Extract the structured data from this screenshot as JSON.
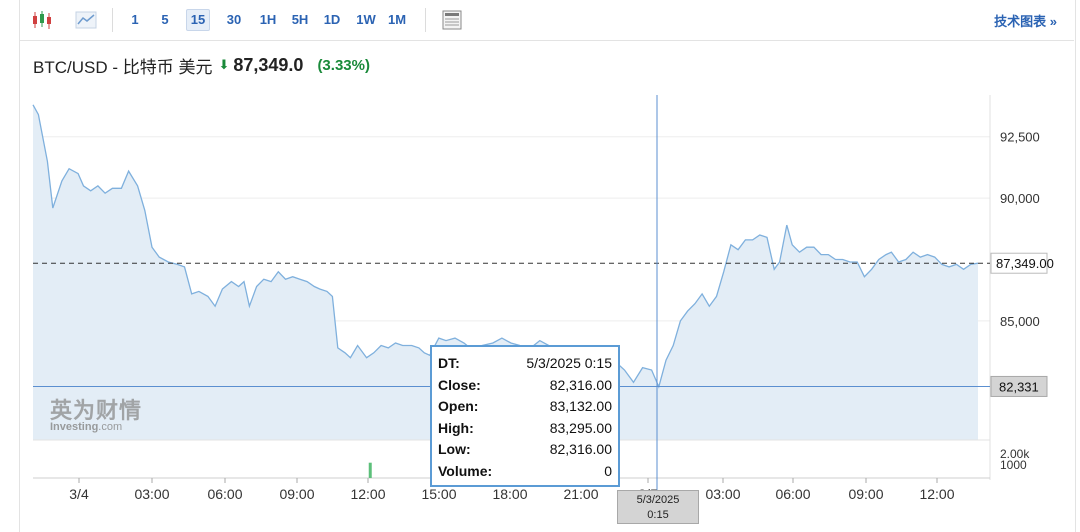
{
  "toolbar": {
    "intervals": [
      "1",
      "5",
      "15",
      "30",
      "1H",
      "5H",
      "1D",
      "1W",
      "1M"
    ],
    "active_interval": "15",
    "tech_link": "技术图表 »"
  },
  "header": {
    "symbol": "BTC/USD - 比特币 美元",
    "arrow": "⬇",
    "price": "87,349.0",
    "change": "(3.33%)",
    "change_color": "#1a8a3a"
  },
  "watermark": {
    "cn": "英为财情",
    "en_bold": "Investing",
    "en_suffix": ".com"
  },
  "tooltip": {
    "rows": [
      {
        "k": "DT:",
        "v": "5/3/2025 0:15"
      },
      {
        "k": "Close:",
        "v": "82,316.00"
      },
      {
        "k": "Open:",
        "v": "83,132.00"
      },
      {
        "k": "High:",
        "v": "83,295.00"
      },
      {
        "k": "Low:",
        "v": "82,316.00"
      },
      {
        "k": "Volume:",
        "v": "0"
      }
    ]
  },
  "crosshair_label": {
    "line1": "5/3/2025",
    "line2": "0:15"
  },
  "chart_data": {
    "type": "area",
    "series_color": "#7fb0dd",
    "fill_color": "#e3edf6",
    "y_ticks": [
      85000,
      87500,
      90000,
      92500
    ],
    "y_tick_labels": [
      "85,000",
      "87,349.00",
      "90,000",
      "92,500"
    ],
    "y_ticks_shown": [
      {
        "value": 92500,
        "label": "92,500"
      },
      {
        "value": 90000,
        "label": "90,000"
      },
      {
        "value": 85000,
        "label": "85,000"
      }
    ],
    "ylim": [
      80150,
      94200
    ],
    "current_price": {
      "value": 87349,
      "label": "87,349.00"
    },
    "crosshair_price": {
      "value": 82331,
      "label": "82,331"
    },
    "x_tick_labels": [
      "3/4",
      "03:00",
      "06:00",
      "09:00",
      "12:00",
      "15:00",
      "18:00",
      "21:00",
      "3/5",
      "03:00",
      "06:00",
      "09:00",
      "12:00"
    ],
    "volume_labels": [
      "2.00k",
      "1000"
    ],
    "volume_bars": [
      {
        "t": 18.7,
        "value": 900,
        "color": "#5cbf7a"
      },
      {
        "t": 29.4,
        "value": 1050,
        "color": "#e04848"
      }
    ],
    "points": [
      [
        0,
        93800
      ],
      [
        0.3,
        93400
      ],
      [
        0.8,
        91500
      ],
      [
        1.1,
        89600
      ],
      [
        1.6,
        90700
      ],
      [
        2.0,
        91200
      ],
      [
        2.5,
        91000
      ],
      [
        2.8,
        90500
      ],
      [
        3.2,
        90300
      ],
      [
        3.6,
        90500
      ],
      [
        4.0,
        90200
      ],
      [
        4.4,
        90400
      ],
      [
        4.9,
        90400
      ],
      [
        5.3,
        91100
      ],
      [
        5.8,
        90500
      ],
      [
        6.2,
        89500
      ],
      [
        6.6,
        88000
      ],
      [
        7.0,
        87600
      ],
      [
        7.5,
        87400
      ],
      [
        8.0,
        87300
      ],
      [
        8.4,
        87200
      ],
      [
        8.8,
        86100
      ],
      [
        9.2,
        86200
      ],
      [
        9.7,
        86000
      ],
      [
        10.1,
        85600
      ],
      [
        10.5,
        86300
      ],
      [
        11.0,
        86600
      ],
      [
        11.4,
        86400
      ],
      [
        11.7,
        86600
      ],
      [
        12.0,
        85600
      ],
      [
        12.4,
        86400
      ],
      [
        12.8,
        86700
      ],
      [
        13.2,
        86600
      ],
      [
        13.6,
        87000
      ],
      [
        14.0,
        86700
      ],
      [
        14.4,
        86800
      ],
      [
        14.8,
        86700
      ],
      [
        15.2,
        86600
      ],
      [
        15.6,
        86400
      ],
      [
        15.9,
        86300
      ],
      [
        16.3,
        86200
      ],
      [
        16.6,
        86000
      ],
      [
        16.9,
        83900
      ],
      [
        17.3,
        83700
      ],
      [
        17.6,
        83500
      ],
      [
        18.0,
        84000
      ],
      [
        18.5,
        83500
      ],
      [
        18.9,
        83700
      ],
      [
        19.3,
        84000
      ],
      [
        19.7,
        83900
      ],
      [
        20.1,
        84100
      ],
      [
        20.5,
        84000
      ],
      [
        21.0,
        84000
      ],
      [
        21.4,
        83900
      ],
      [
        21.7,
        83700
      ],
      [
        22.0,
        83600
      ],
      [
        22.5,
        84300
      ],
      [
        22.9,
        84200
      ],
      [
        23.4,
        84300
      ],
      [
        23.9,
        84100
      ],
      [
        24.4,
        83800
      ],
      [
        24.9,
        84000
      ],
      [
        25.5,
        84100
      ],
      [
        26.0,
        84300
      ],
      [
        26.5,
        84100
      ],
      [
        27.0,
        84000
      ],
      [
        27.6,
        83900
      ],
      [
        28.1,
        84200
      ],
      [
        28.6,
        84000
      ],
      [
        29.1,
        83500
      ],
      [
        29.6,
        83600
      ],
      [
        30.2,
        83700
      ],
      [
        30.7,
        83400
      ],
      [
        31.2,
        82800
      ],
      [
        31.7,
        82900
      ],
      [
        32.2,
        83400
      ],
      [
        32.8,
        83000
      ],
      [
        33.3,
        82500
      ],
      [
        33.8,
        83100
      ],
      [
        34.3,
        83000
      ],
      [
        34.7,
        82316
      ],
      [
        35.1,
        83400
      ],
      [
        35.5,
        84000
      ],
      [
        35.9,
        85000
      ],
      [
        36.3,
        85400
      ],
      [
        36.7,
        85700
      ],
      [
        37.1,
        86100
      ],
      [
        37.5,
        85600
      ],
      [
        37.9,
        86000
      ],
      [
        38.3,
        87000
      ],
      [
        38.7,
        88100
      ],
      [
        39.1,
        87900
      ],
      [
        39.5,
        88300
      ],
      [
        39.9,
        88300
      ],
      [
        40.3,
        88500
      ],
      [
        40.7,
        88400
      ],
      [
        41.1,
        87100
      ],
      [
        41.4,
        87400
      ],
      [
        41.8,
        88900
      ],
      [
        42.1,
        88100
      ],
      [
        42.5,
        87800
      ],
      [
        42.9,
        88000
      ],
      [
        43.3,
        88000
      ],
      [
        43.7,
        87700
      ],
      [
        44.1,
        87700
      ],
      [
        44.5,
        87500
      ],
      [
        44.9,
        87500
      ],
      [
        45.3,
        87400
      ],
      [
        45.7,
        87400
      ],
      [
        46.1,
        86800
      ],
      [
        46.5,
        87100
      ],
      [
        46.9,
        87500
      ],
      [
        47.3,
        87700
      ],
      [
        47.6,
        87800
      ],
      [
        48.0,
        87400
      ],
      [
        48.4,
        87500
      ],
      [
        48.8,
        87800
      ],
      [
        49.2,
        87600
      ],
      [
        49.6,
        87700
      ],
      [
        50.0,
        87600
      ],
      [
        50.4,
        87300
      ],
      [
        50.8,
        87200
      ],
      [
        51.2,
        87300
      ],
      [
        51.6,
        87100
      ],
      [
        52.0,
        87300
      ],
      [
        52.4,
        87349
      ]
    ]
  }
}
